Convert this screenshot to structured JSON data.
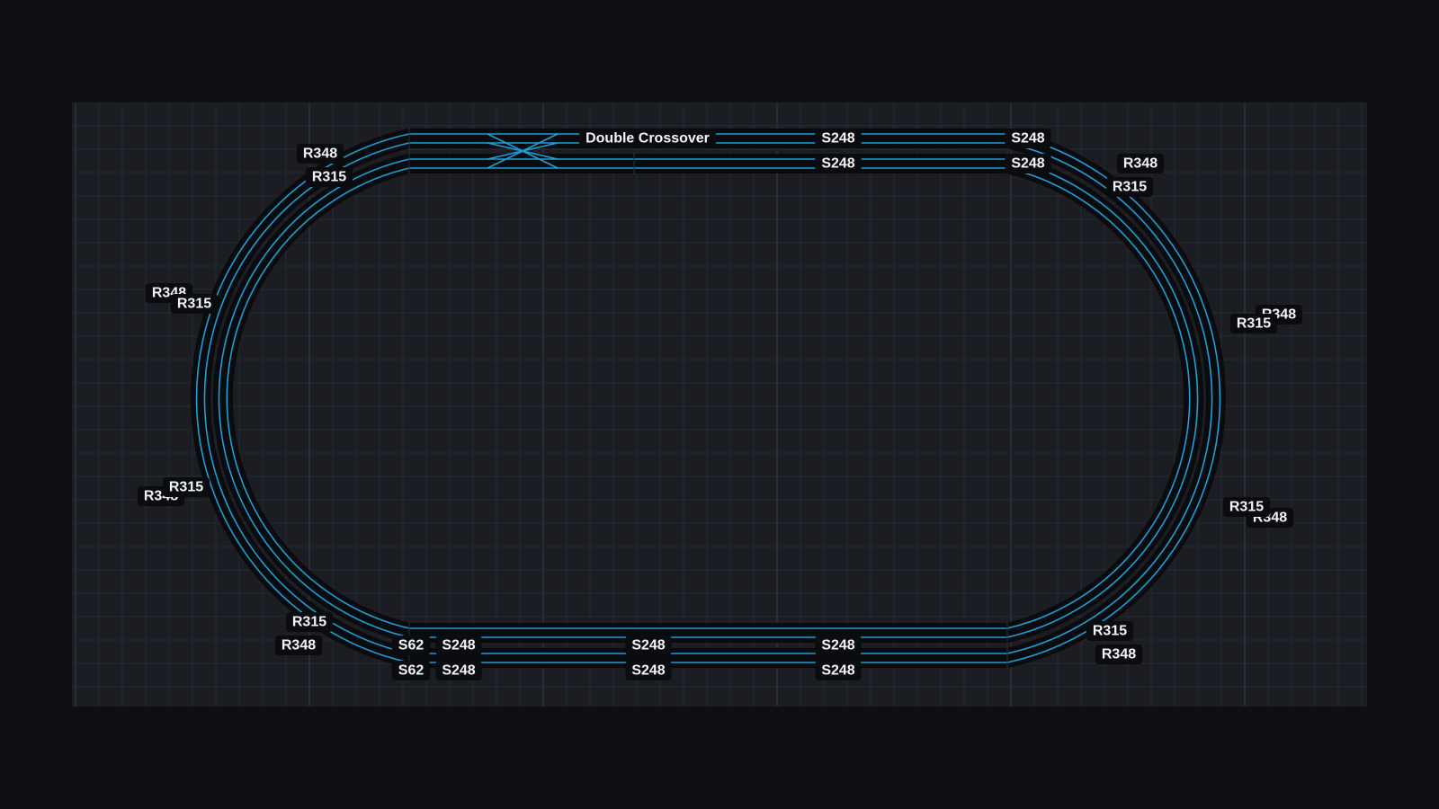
{
  "colors": {
    "rail": "#1d9fd6",
    "sleeper": "#0a0b0e",
    "grid_minor": "#262933",
    "grid_major": "#383c47",
    "canvas": "#1b1d23"
  },
  "labels": [
    {
      "id": "crossover",
      "text": "Double Crossover"
    },
    {
      "id": "top-outer-1",
      "text": "S248"
    },
    {
      "id": "top-outer-2",
      "text": "S248"
    },
    {
      "id": "top-inner-1",
      "text": "S248"
    },
    {
      "id": "top-inner-2",
      "text": "S248"
    },
    {
      "id": "tl-outer",
      "text": "R348"
    },
    {
      "id": "tl-inner",
      "text": "R315"
    },
    {
      "id": "tr-outer",
      "text": "R348"
    },
    {
      "id": "tr-inner",
      "text": "R315"
    },
    {
      "id": "l-up-outer",
      "text": "R348"
    },
    {
      "id": "l-up-inner",
      "text": "R315"
    },
    {
      "id": "l-lo-outer",
      "text": "R348"
    },
    {
      "id": "l-lo-inner",
      "text": "R315"
    },
    {
      "id": "r-up-outer",
      "text": "R348"
    },
    {
      "id": "r-up-inner",
      "text": "R315"
    },
    {
      "id": "r-lo-outer",
      "text": "R348"
    },
    {
      "id": "r-lo-inner",
      "text": "R315"
    },
    {
      "id": "bl-inner",
      "text": "R315"
    },
    {
      "id": "bl-outer",
      "text": "R348"
    },
    {
      "id": "br-inner",
      "text": "R315"
    },
    {
      "id": "br-outer",
      "text": "R348"
    },
    {
      "id": "bot-inner-s62",
      "text": "S62"
    },
    {
      "id": "bot-inner-1",
      "text": "S248"
    },
    {
      "id": "bot-inner-2",
      "text": "S248"
    },
    {
      "id": "bot-inner-3",
      "text": "S248"
    },
    {
      "id": "bot-outer-s62",
      "text": "S62"
    },
    {
      "id": "bot-outer-1",
      "text": "S248"
    },
    {
      "id": "bot-outer-2",
      "text": "S248"
    },
    {
      "id": "bot-outer-3",
      "text": "S248"
    }
  ]
}
